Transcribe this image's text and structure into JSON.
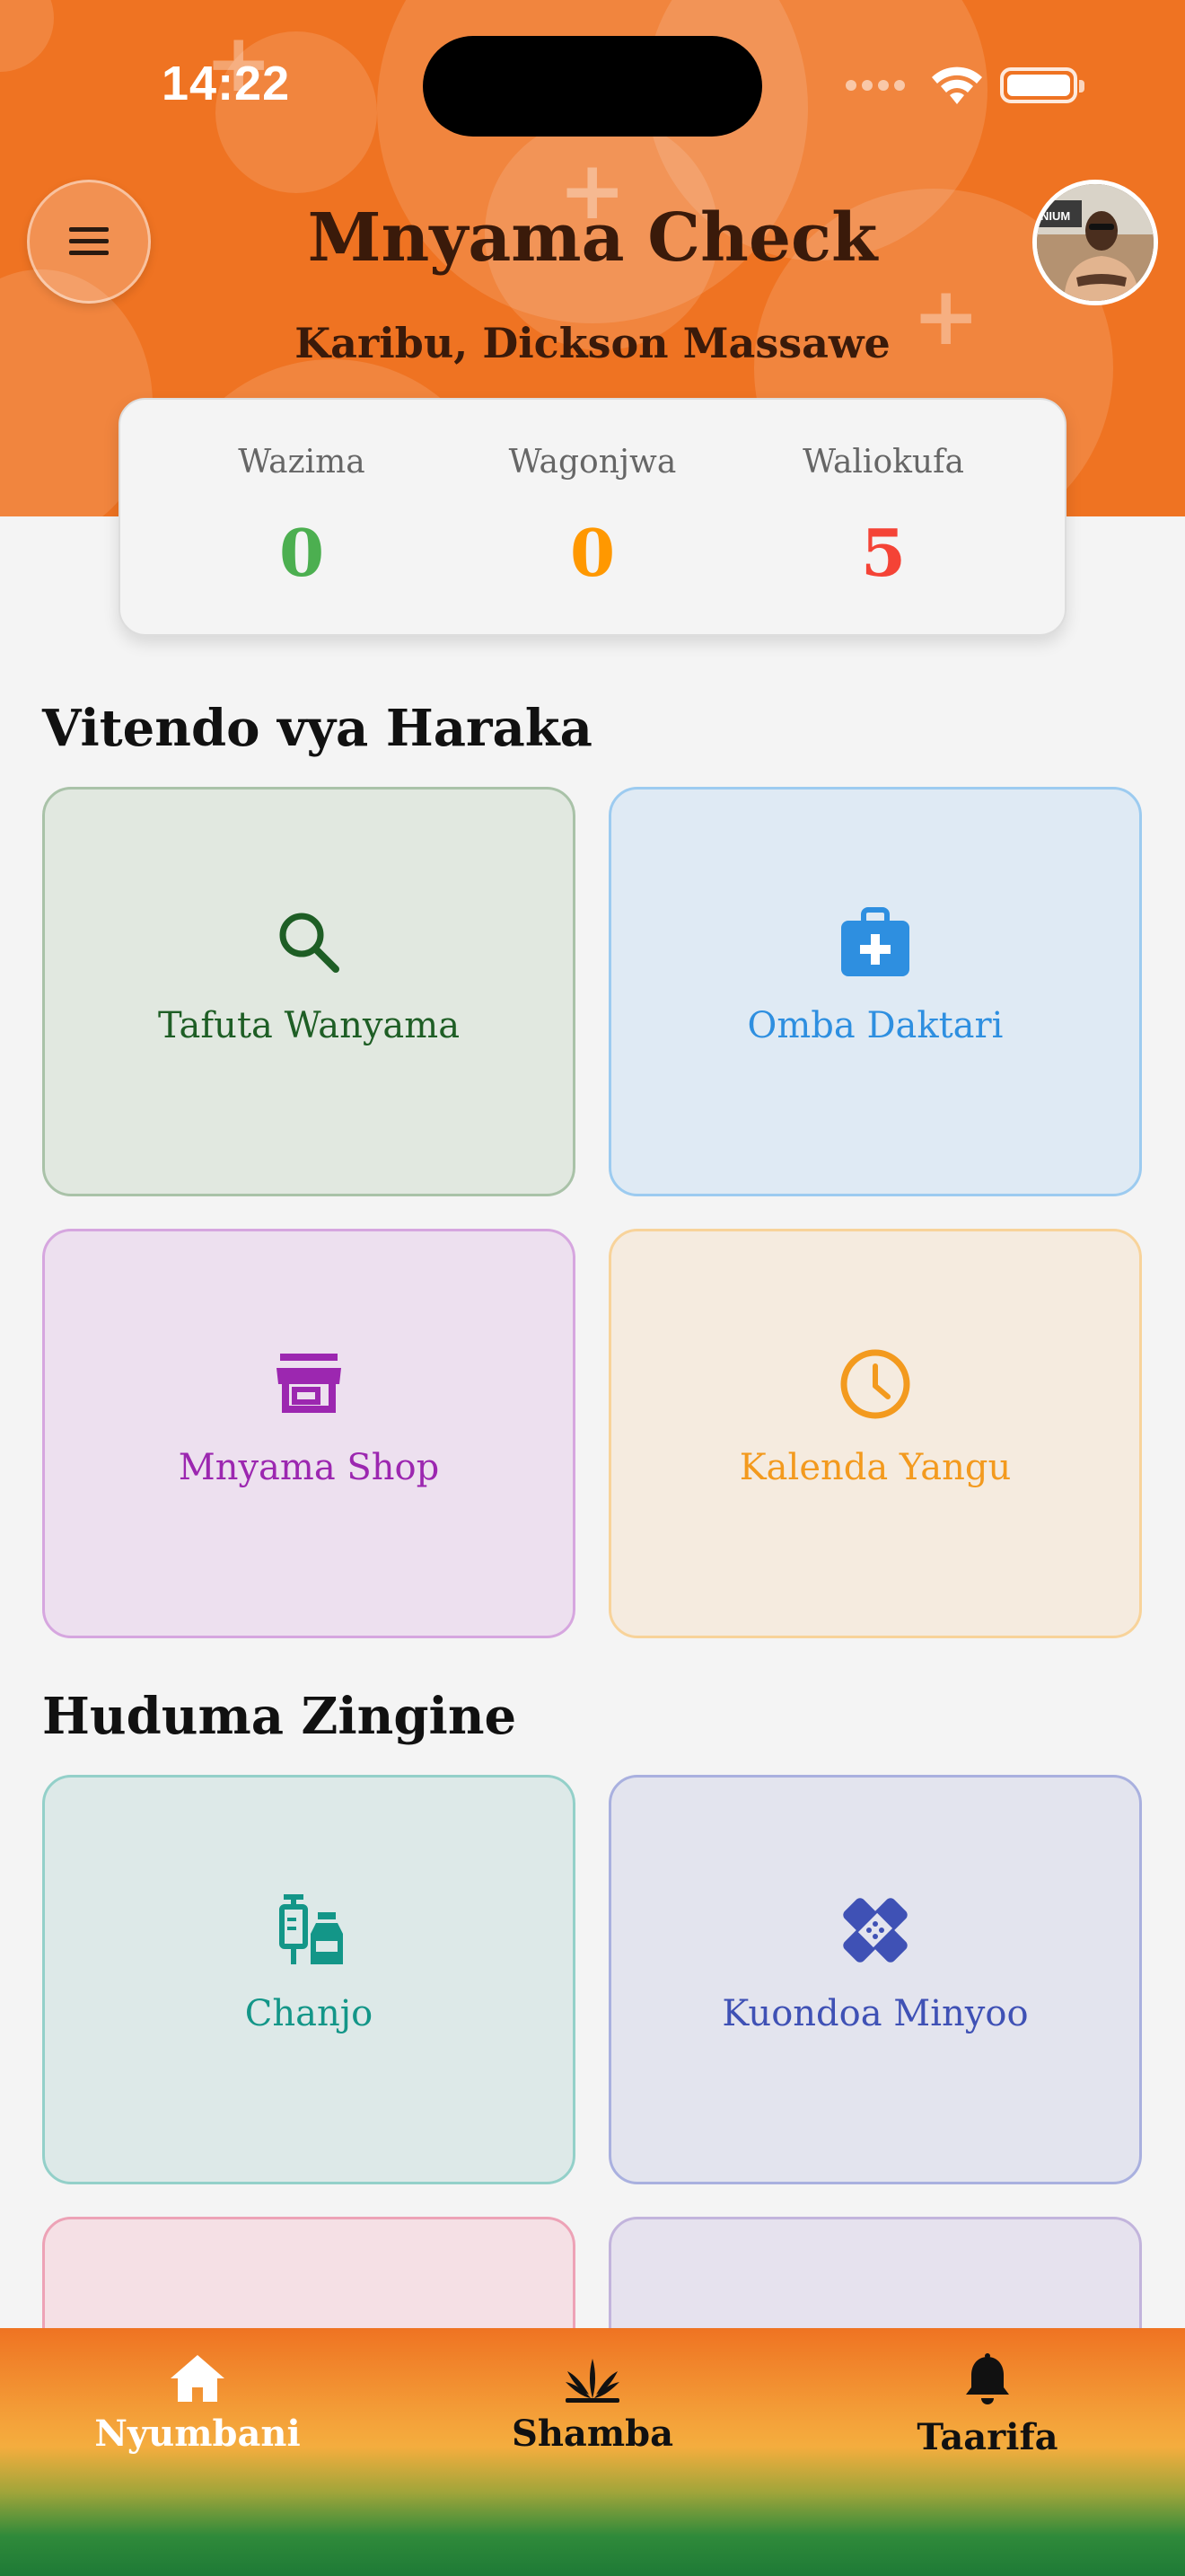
{
  "status_bar": {
    "time": "14:22"
  },
  "header": {
    "title": "Mnyama Check",
    "greeting": "Karibu, Dickson Massawe",
    "avatar_badge": "NIUM"
  },
  "stats": [
    {
      "label": "Wazima",
      "value": "0",
      "color": "#4caf50"
    },
    {
      "label": "Wagonjwa",
      "value": "0",
      "color": "#ff9800"
    },
    {
      "label": "Waliokufa",
      "value": "5",
      "color": "#f44336"
    }
  ],
  "quick_actions": {
    "title": "Vitendo vya Haraka",
    "items": [
      {
        "label": "Tafuta Wanyama",
        "icon": "search-icon",
        "color": "#1e5e25"
      },
      {
        "label": "Omba Daktari",
        "icon": "medical-bag-icon",
        "color": "#2e8fe0"
      },
      {
        "label": "Mnyama Shop",
        "icon": "store-icon",
        "color": "#9c27b0"
      },
      {
        "label": "Kalenda Yangu",
        "icon": "clock-icon",
        "color": "#f39a1e"
      }
    ]
  },
  "other_services": {
    "title": "Huduma Zingine",
    "items": [
      {
        "label": "Chanjo",
        "icon": "vaccine-icon",
        "color": "#139688"
      },
      {
        "label": "Kuondoa Minyoo",
        "icon": "bandage-icon",
        "color": "#3f51b5"
      }
    ]
  },
  "bottom_nav": {
    "items": [
      {
        "label": "Nyumbani",
        "icon": "home-icon",
        "active": true
      },
      {
        "label": "Shamba",
        "icon": "plant-icon",
        "active": false
      },
      {
        "label": "Taarifa",
        "icon": "bell-icon",
        "active": false
      }
    ]
  }
}
